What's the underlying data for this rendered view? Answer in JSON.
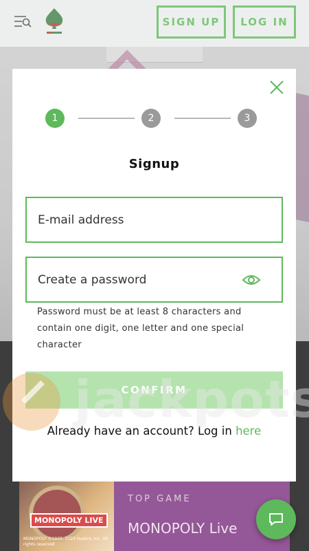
{
  "header": {
    "signup_label": "SIGN UP",
    "login_label": "LOG IN",
    "accent_color": "#5db95b"
  },
  "modal": {
    "steps": [
      "1",
      "2",
      "3"
    ],
    "active_step": 1,
    "title": "Signup",
    "email_placeholder": "E-mail address",
    "password_placeholder": "Create a password",
    "password_hint": "Password must be at least 8 characters and contain one digit, one letter and one special character",
    "confirm_label": "CONFIRM",
    "login_prompt_text": "Already have an account? Log in ",
    "login_link_label": "here"
  },
  "watermark": {
    "text": "jackpots"
  },
  "game_card": {
    "tag": "TOP GAME",
    "name": "MONOPOLY Live",
    "image_logo": "MONOPOLY LIVE",
    "image_copyright": "MONOPOLY ©1935, 2020 Hasbro, Inc. All rights reserved"
  },
  "icons": {
    "menu": "menu-search-icon",
    "close": "close-icon",
    "eye": "eye-icon",
    "chat": "chat-icon"
  }
}
